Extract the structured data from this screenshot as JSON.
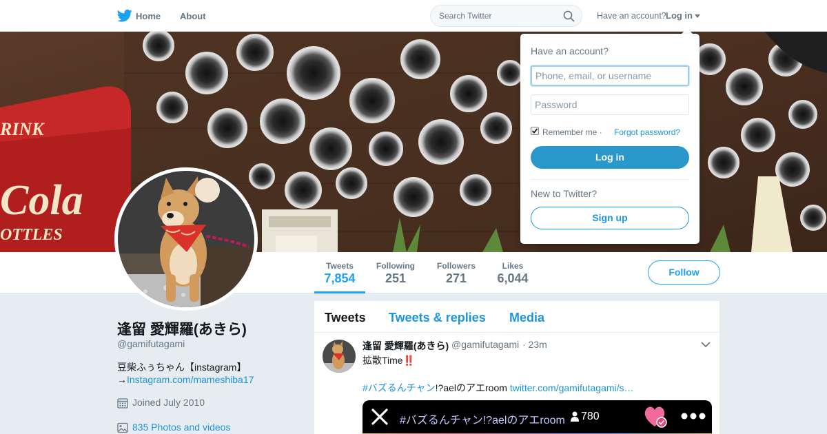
{
  "nav": {
    "home_label": "Home",
    "about_label": "About",
    "search_placeholder": "Search Twitter",
    "have_account": "Have an account?",
    "login_label": "Log in"
  },
  "profile": {
    "name": "逢留 愛輝羅(あきら)",
    "handle": "@gamifutagami",
    "bio_line1": "豆柴ふぅちゃん【instagram】",
    "bio_arrow": "→",
    "bio_link": "Instagram.com/mameshiba17",
    "joined": "Joined July 2010",
    "photos": "835 Photos and videos"
  },
  "stats": [
    {
      "label": "Tweets",
      "value": "7,854"
    },
    {
      "label": "Following",
      "value": "251"
    },
    {
      "label": "Followers",
      "value": "271"
    },
    {
      "label": "Likes",
      "value": "6,044"
    }
  ],
  "follow_label": "Follow",
  "timeline": {
    "tabs": [
      "Tweets",
      "Tweets & replies",
      "Media"
    ],
    "tweet": {
      "name": "逢留 愛輝羅(あきら)",
      "handle": "@gamifutagami",
      "time": "· 23m",
      "text1": "拡散Time",
      "text1_emoji": "‼️",
      "hashtag": "#バズるんチャン",
      "text2": "!?aelのアエroom",
      "link": "twitter.com/gamifutagami/s…",
      "media_tag": "#バズるんチャン!?aelのアエroom",
      "media_count": "780"
    }
  },
  "login_dropdown": {
    "title": "Have an account?",
    "username_placeholder": "Phone, email, or username",
    "password_placeholder": "Password",
    "remember_label": "Remember me ·",
    "forgot_label": "Forgot password?",
    "remember_checked": true,
    "login_button": "Log in",
    "new_label": "New to Twitter?",
    "signup_button": "Sign up"
  },
  "colors": {
    "brand": "#1da1f2",
    "link": "#1b95e0",
    "text_secondary": "#657786",
    "background": "#e6ecf0"
  }
}
